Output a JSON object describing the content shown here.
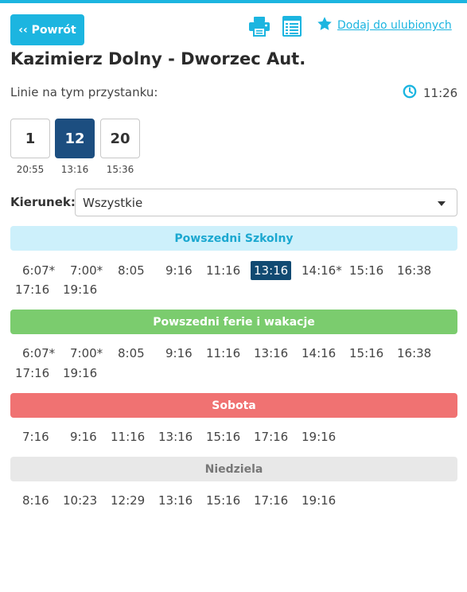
{
  "header": {
    "back_label": "‹‹ Powrót",
    "favorite_label": "Dodaj do ulubionych"
  },
  "title": "Kazimierz Dolny - Dworzec Aut.",
  "lines_label": "Linie na tym przystanku:",
  "clock_time": "11:26",
  "lines": [
    {
      "number": "1",
      "time": "20:55",
      "active": false
    },
    {
      "number": "12",
      "time": "13:16",
      "active": true
    },
    {
      "number": "20",
      "time": "15:36",
      "active": false
    }
  ],
  "direction": {
    "label": "Kierunek:",
    "value": "Wszystkie"
  },
  "colors": {
    "accent": "#1cb5e0",
    "active_line": "#1c4e80",
    "highlight_time": "#114a72",
    "school_bg": "#cdf0fb",
    "school_fg": "#1ca8d0",
    "holiday_bg": "#7bcc6e",
    "holiday_fg": "#ffffff",
    "saturday_bg": "#f07272",
    "saturday_fg": "#ffffff",
    "sunday_bg": "#e8e8e8",
    "sunday_fg": "#777777"
  },
  "schedules": [
    {
      "title": "Powszedni Szkolny",
      "rows": [
        [
          "6:07*",
          "7:00*",
          "8:05",
          "9:16",
          "11:16",
          "13:16",
          "14:16*",
          "15:16",
          "16:38"
        ],
        [
          "17:16",
          "19:16"
        ]
      ],
      "highlight": "13:16"
    },
    {
      "title": "Powszedni ferie i wakacje",
      "rows": [
        [
          "6:07*",
          "7:00*",
          "8:05",
          "9:16",
          "11:16",
          "13:16",
          "14:16",
          "15:16",
          "16:38"
        ],
        [
          "17:16",
          "19:16"
        ]
      ]
    },
    {
      "title": "Sobota",
      "rows": [
        [
          "7:16",
          "9:16",
          "11:16",
          "13:16",
          "15:16",
          "17:16",
          "19:16"
        ]
      ]
    },
    {
      "title": "Niedziela",
      "rows": [
        [
          "8:16",
          "10:23",
          "12:29",
          "13:16",
          "15:16",
          "17:16",
          "19:16"
        ]
      ]
    }
  ]
}
